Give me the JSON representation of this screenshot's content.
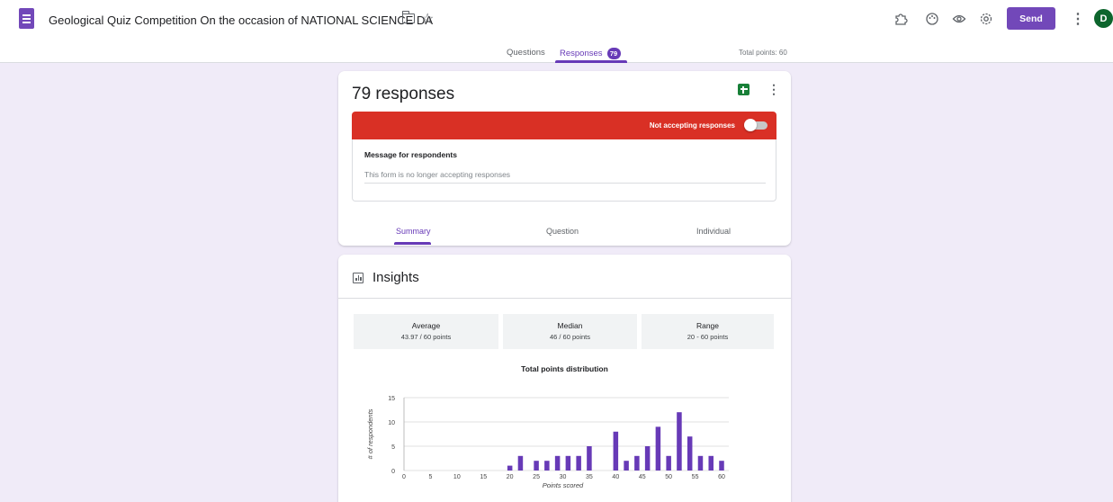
{
  "header": {
    "title": "Geological Quiz Competition On the occasion of NATIONAL SCIENCE DA",
    "send_label": "Send",
    "avatar_letter": "D"
  },
  "tabs": {
    "questions": "Questions",
    "responses": "Responses",
    "responses_count": "79",
    "total_points": "Total points: 60"
  },
  "responses_card": {
    "title": "79 responses",
    "not_accepting": "Not accepting responses",
    "message_label": "Message for respondents",
    "message_value": "This form is no longer accepting responses",
    "subtabs": [
      "Summary",
      "Question",
      "Individual"
    ]
  },
  "insights": {
    "title": "Insights",
    "stats": [
      {
        "label": "Average",
        "value": "43.97 / 60 points"
      },
      {
        "label": "Median",
        "value": "46 / 60 points"
      },
      {
        "label": "Range",
        "value": "20 - 60 points"
      }
    ]
  },
  "colors": {
    "accent": "#673ab7",
    "brand_purple": "#7248b9",
    "red_banner": "#d93025",
    "avatar_green": "#0d652d",
    "sheets_green": "#188038",
    "page_background": "#f0ebf8"
  },
  "chart_data": {
    "type": "bar",
    "title": "Total points distribution",
    "xlabel": "Points scored",
    "ylabel": "# of respondents",
    "xlim": [
      0,
      60
    ],
    "ylim": [
      0,
      15
    ],
    "x_ticks": [
      "0",
      "5",
      "10",
      "15",
      "20",
      "25",
      "30",
      "35",
      "40",
      "45",
      "50",
      "55",
      "60"
    ],
    "y_ticks": [
      "0",
      "5",
      "10",
      "15"
    ],
    "grid": true,
    "x": [
      20,
      22,
      25,
      27,
      29,
      31,
      33,
      35,
      40,
      42,
      44,
      46,
      48,
      50,
      52,
      54,
      56,
      58,
      60
    ],
    "values": [
      1,
      3,
      2,
      2,
      3,
      3,
      3,
      5,
      8,
      2,
      3,
      5,
      9,
      3,
      12,
      7,
      3,
      3,
      2
    ]
  }
}
